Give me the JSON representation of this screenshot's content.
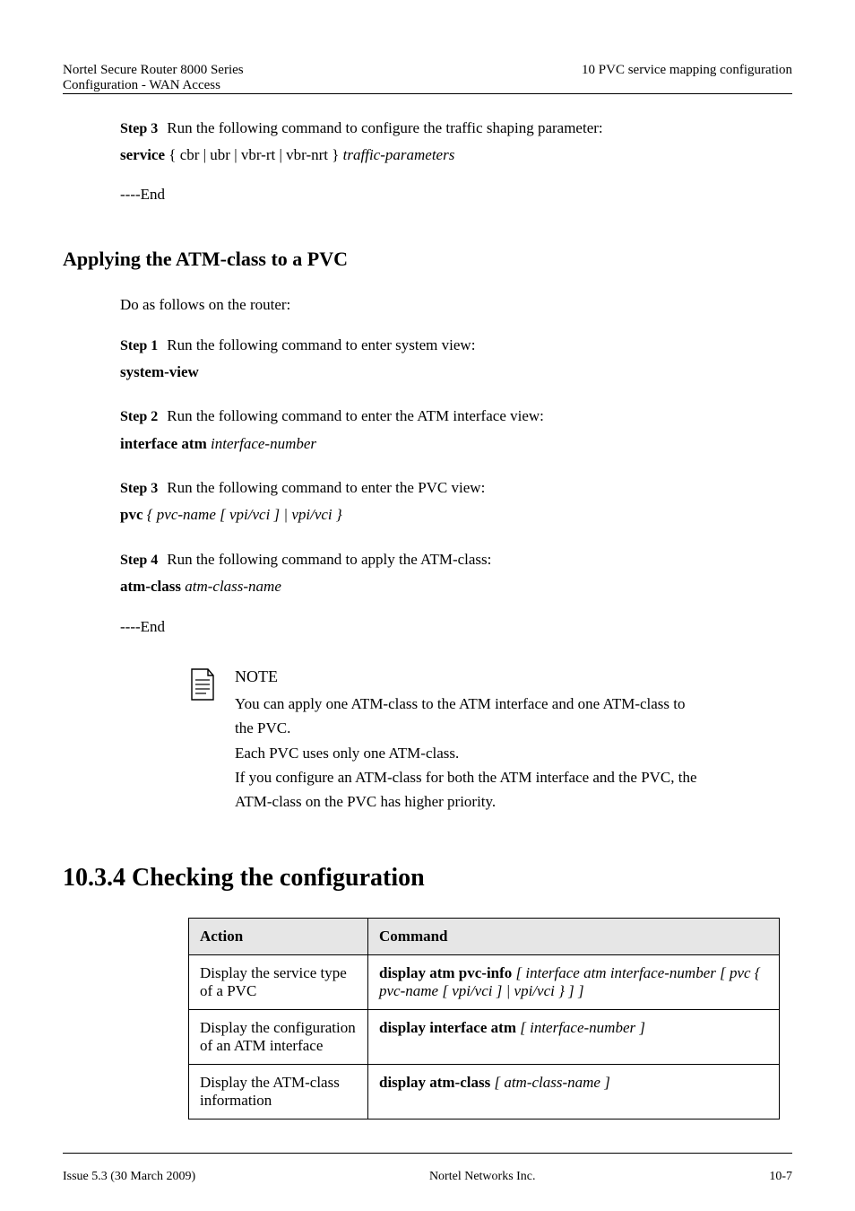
{
  "header": {
    "right_doc_title": "Nortel Secure Router 8000 Series",
    "right_chapter": "10 PVC service mapping configuration",
    "left_doc_title": "Configuration - WAN Access"
  },
  "step3a": {
    "label": "Step 3",
    "intro": "Run the following command to configure the traffic shaping parameter:",
    "cmd": "service",
    "cmd_args_plain": " { cbr | ubr | vbr-rt | vbr-nrt } ",
    "arg_tail": "traffic-parameters"
  },
  "subsection_title": "Applying the ATM-class to a PVC",
  "subsection_intro": "Do as follows on the router:",
  "pvc_step1": {
    "label": "Step 1",
    "intro": "Run the following command to enter system view:",
    "cmd": "system-view"
  },
  "pvc_step2": {
    "label": "Step 2",
    "intro": "Run the following command to enter the ATM interface view:",
    "cmd": "interface atm",
    "arg": " interface-number"
  },
  "pvc_step3": {
    "label": "Step 3",
    "intro": "Run the following command to enter the PVC view:",
    "cmd": "pvc",
    "arg_full": " { pvc-name [ vpi/vci ] | vpi/vci }"
  },
  "pvc_step4": {
    "label": "Step 4",
    "intro": "Run the following command to apply the ATM-class:",
    "cmd": "atm-class",
    "arg": " atm-class-name"
  },
  "end_marker": "----End",
  "note": {
    "title": "NOTE",
    "lines": [
      "You can apply one ATM-class to the ATM interface and one ATM-class to the PVC.",
      "Each PVC uses only one ATM-class.",
      "If you configure an ATM-class for both the ATM interface and the PVC, the ATM-class on the PVC has higher priority."
    ]
  },
  "section": {
    "number": "10.3.4",
    "title": "Checking the configuration"
  },
  "table": {
    "head_action": "Action",
    "head_command": "Command",
    "rows": [
      {
        "action": "Display the service type of a PVC",
        "cmd": "display atm pvc-info",
        "arg": " [ interface atm interface-number [ pvc { pvc-name [ vpi/vci ] | vpi/vci } ] ]"
      },
      {
        "action": "Display the configuration of an ATM interface",
        "cmd": "display interface atm",
        "arg": " [ interface-number ]"
      },
      {
        "action": "Display the ATM-class information",
        "cmd": "display atm-class",
        "arg": " [ atm-class-name ]"
      }
    ]
  },
  "footer": {
    "left": "Issue 5.3 (30 March 2009)",
    "center": "Nortel Networks Inc.",
    "right": "10-7"
  }
}
